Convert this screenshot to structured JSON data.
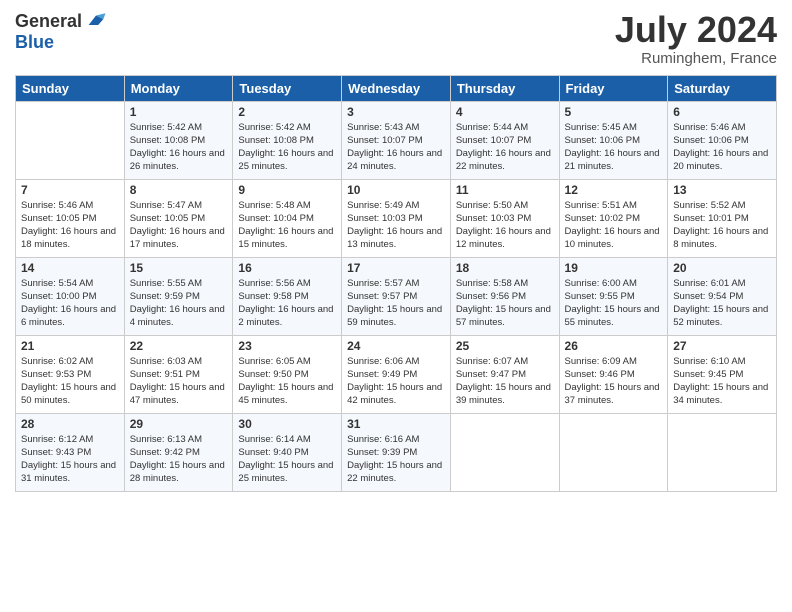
{
  "header": {
    "logo_general": "General",
    "logo_blue": "Blue",
    "month_title": "July 2024",
    "location": "Ruminghem, France"
  },
  "calendar": {
    "days_of_week": [
      "Sunday",
      "Monday",
      "Tuesday",
      "Wednesday",
      "Thursday",
      "Friday",
      "Saturday"
    ],
    "weeks": [
      [
        {
          "day": "",
          "sunrise": "",
          "sunset": "",
          "daylight": ""
        },
        {
          "day": "1",
          "sunrise": "Sunrise: 5:42 AM",
          "sunset": "Sunset: 10:08 PM",
          "daylight": "Daylight: 16 hours and 26 minutes."
        },
        {
          "day": "2",
          "sunrise": "Sunrise: 5:42 AM",
          "sunset": "Sunset: 10:08 PM",
          "daylight": "Daylight: 16 hours and 25 minutes."
        },
        {
          "day": "3",
          "sunrise": "Sunrise: 5:43 AM",
          "sunset": "Sunset: 10:07 PM",
          "daylight": "Daylight: 16 hours and 24 minutes."
        },
        {
          "day": "4",
          "sunrise": "Sunrise: 5:44 AM",
          "sunset": "Sunset: 10:07 PM",
          "daylight": "Daylight: 16 hours and 22 minutes."
        },
        {
          "day": "5",
          "sunrise": "Sunrise: 5:45 AM",
          "sunset": "Sunset: 10:06 PM",
          "daylight": "Daylight: 16 hours and 21 minutes."
        },
        {
          "day": "6",
          "sunrise": "Sunrise: 5:46 AM",
          "sunset": "Sunset: 10:06 PM",
          "daylight": "Daylight: 16 hours and 20 minutes."
        }
      ],
      [
        {
          "day": "7",
          "sunrise": "Sunrise: 5:46 AM",
          "sunset": "Sunset: 10:05 PM",
          "daylight": "Daylight: 16 hours and 18 minutes."
        },
        {
          "day": "8",
          "sunrise": "Sunrise: 5:47 AM",
          "sunset": "Sunset: 10:05 PM",
          "daylight": "Daylight: 16 hours and 17 minutes."
        },
        {
          "day": "9",
          "sunrise": "Sunrise: 5:48 AM",
          "sunset": "Sunset: 10:04 PM",
          "daylight": "Daylight: 16 hours and 15 minutes."
        },
        {
          "day": "10",
          "sunrise": "Sunrise: 5:49 AM",
          "sunset": "Sunset: 10:03 PM",
          "daylight": "Daylight: 16 hours and 13 minutes."
        },
        {
          "day": "11",
          "sunrise": "Sunrise: 5:50 AM",
          "sunset": "Sunset: 10:03 PM",
          "daylight": "Daylight: 16 hours and 12 minutes."
        },
        {
          "day": "12",
          "sunrise": "Sunrise: 5:51 AM",
          "sunset": "Sunset: 10:02 PM",
          "daylight": "Daylight: 16 hours and 10 minutes."
        },
        {
          "day": "13",
          "sunrise": "Sunrise: 5:52 AM",
          "sunset": "Sunset: 10:01 PM",
          "daylight": "Daylight: 16 hours and 8 minutes."
        }
      ],
      [
        {
          "day": "14",
          "sunrise": "Sunrise: 5:54 AM",
          "sunset": "Sunset: 10:00 PM",
          "daylight": "Daylight: 16 hours and 6 minutes."
        },
        {
          "day": "15",
          "sunrise": "Sunrise: 5:55 AM",
          "sunset": "Sunset: 9:59 PM",
          "daylight": "Daylight: 16 hours and 4 minutes."
        },
        {
          "day": "16",
          "sunrise": "Sunrise: 5:56 AM",
          "sunset": "Sunset: 9:58 PM",
          "daylight": "Daylight: 16 hours and 2 minutes."
        },
        {
          "day": "17",
          "sunrise": "Sunrise: 5:57 AM",
          "sunset": "Sunset: 9:57 PM",
          "daylight": "Daylight: 15 hours and 59 minutes."
        },
        {
          "day": "18",
          "sunrise": "Sunrise: 5:58 AM",
          "sunset": "Sunset: 9:56 PM",
          "daylight": "Daylight: 15 hours and 57 minutes."
        },
        {
          "day": "19",
          "sunrise": "Sunrise: 6:00 AM",
          "sunset": "Sunset: 9:55 PM",
          "daylight": "Daylight: 15 hours and 55 minutes."
        },
        {
          "day": "20",
          "sunrise": "Sunrise: 6:01 AM",
          "sunset": "Sunset: 9:54 PM",
          "daylight": "Daylight: 15 hours and 52 minutes."
        }
      ],
      [
        {
          "day": "21",
          "sunrise": "Sunrise: 6:02 AM",
          "sunset": "Sunset: 9:53 PM",
          "daylight": "Daylight: 15 hours and 50 minutes."
        },
        {
          "day": "22",
          "sunrise": "Sunrise: 6:03 AM",
          "sunset": "Sunset: 9:51 PM",
          "daylight": "Daylight: 15 hours and 47 minutes."
        },
        {
          "day": "23",
          "sunrise": "Sunrise: 6:05 AM",
          "sunset": "Sunset: 9:50 PM",
          "daylight": "Daylight: 15 hours and 45 minutes."
        },
        {
          "day": "24",
          "sunrise": "Sunrise: 6:06 AM",
          "sunset": "Sunset: 9:49 PM",
          "daylight": "Daylight: 15 hours and 42 minutes."
        },
        {
          "day": "25",
          "sunrise": "Sunrise: 6:07 AM",
          "sunset": "Sunset: 9:47 PM",
          "daylight": "Daylight: 15 hours and 39 minutes."
        },
        {
          "day": "26",
          "sunrise": "Sunrise: 6:09 AM",
          "sunset": "Sunset: 9:46 PM",
          "daylight": "Daylight: 15 hours and 37 minutes."
        },
        {
          "day": "27",
          "sunrise": "Sunrise: 6:10 AM",
          "sunset": "Sunset: 9:45 PM",
          "daylight": "Daylight: 15 hours and 34 minutes."
        }
      ],
      [
        {
          "day": "28",
          "sunrise": "Sunrise: 6:12 AM",
          "sunset": "Sunset: 9:43 PM",
          "daylight": "Daylight: 15 hours and 31 minutes."
        },
        {
          "day": "29",
          "sunrise": "Sunrise: 6:13 AM",
          "sunset": "Sunset: 9:42 PM",
          "daylight": "Daylight: 15 hours and 28 minutes."
        },
        {
          "day": "30",
          "sunrise": "Sunrise: 6:14 AM",
          "sunset": "Sunset: 9:40 PM",
          "daylight": "Daylight: 15 hours and 25 minutes."
        },
        {
          "day": "31",
          "sunrise": "Sunrise: 6:16 AM",
          "sunset": "Sunset: 9:39 PM",
          "daylight": "Daylight: 15 hours and 22 minutes."
        },
        {
          "day": "",
          "sunrise": "",
          "sunset": "",
          "daylight": ""
        },
        {
          "day": "",
          "sunrise": "",
          "sunset": "",
          "daylight": ""
        },
        {
          "day": "",
          "sunrise": "",
          "sunset": "",
          "daylight": ""
        }
      ]
    ]
  }
}
